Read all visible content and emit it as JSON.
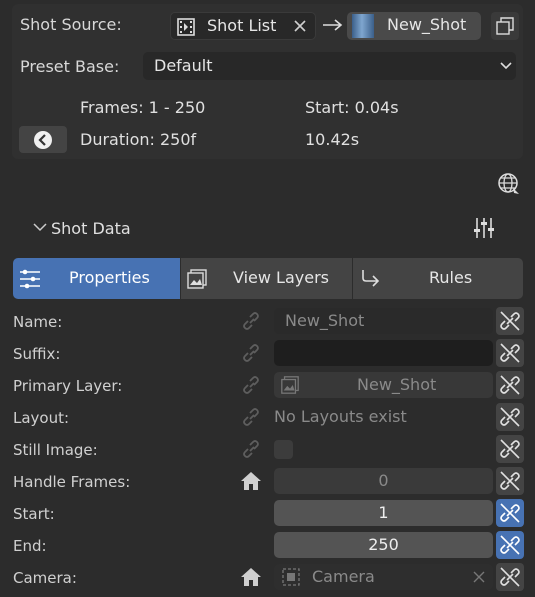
{
  "header": {
    "shot_source_label": "Shot Source:",
    "source_value": "Shot List",
    "target_value": "New_Shot",
    "preset_base_label": "Preset Base:",
    "preset_value": "Default",
    "frames_text": "Frames: 1  -  250",
    "start_text": "Start: 0.04s",
    "duration_text": "Duration: 250f",
    "seconds_text": "10.42s"
  },
  "section": {
    "title": "Shot Data"
  },
  "tabs": [
    {
      "label": "Properties",
      "active": true,
      "icon": "properties-icon"
    },
    {
      "label": "View Layers",
      "active": false,
      "icon": "view-layers-icon"
    },
    {
      "label": "Rules",
      "active": false,
      "icon": "rules-icon"
    }
  ],
  "rows": {
    "name": {
      "label": "Name:",
      "value": "New_Shot"
    },
    "suffix": {
      "label": "Suffix:",
      "value": ""
    },
    "primary_layer": {
      "label": "Primary Layer:",
      "value": "New_Shot"
    },
    "layout": {
      "label": "Layout:",
      "value": "No Layouts exist"
    },
    "still_image": {
      "label": "Still Image:"
    },
    "handle_frames": {
      "label": "Handle Frames:",
      "value": "0"
    },
    "start": {
      "label": "Start:",
      "value": "1"
    },
    "end": {
      "label": "End:",
      "value": "250"
    },
    "camera": {
      "label": "Camera:",
      "value": "Camera"
    }
  },
  "colors": {
    "accent": "#4772b3",
    "background": "#2c2c2c"
  }
}
